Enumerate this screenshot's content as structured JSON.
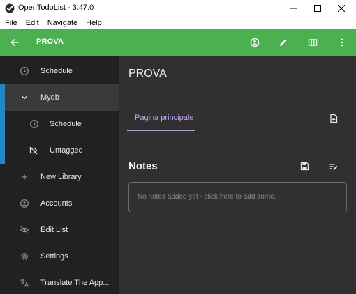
{
  "window": {
    "title": "OpenTodoList - 3.47.0",
    "controls": [
      "minimize-icon",
      "maximize-icon",
      "close-icon"
    ]
  },
  "menubar": {
    "items": [
      "File",
      "Edit",
      "Navigate",
      "Help"
    ]
  },
  "appbar": {
    "title": "PROVA",
    "back_icon": "arrow-left-icon",
    "actions": [
      "account-icon",
      "pencil-icon",
      "columns-icon",
      "more-vert-icon"
    ],
    "color": "#4caf50"
  },
  "sidebar": {
    "accent_color": "#1e88c8",
    "items": [
      {
        "label": "Schedule",
        "icon": "clock-icon"
      },
      {
        "label": "Mydb",
        "icon": "chevron-down-icon",
        "selected": true
      },
      {
        "label": "Schedule",
        "icon": "clock-icon"
      },
      {
        "label": "Untagged",
        "icon": "tag-off-icon"
      },
      {
        "label": "New Library",
        "icon": "plus-icon"
      },
      {
        "label": "Accounts",
        "icon": "account-icon"
      },
      {
        "label": "Edit List",
        "icon": "eye-off-icon"
      },
      {
        "label": "Settings",
        "icon": "gear-icon"
      },
      {
        "label": "Translate The App...",
        "icon": "translate-icon"
      }
    ]
  },
  "main": {
    "page_title": "PROVA",
    "tabs": [
      {
        "label": "Pagina principale",
        "active": true
      }
    ],
    "notes": {
      "heading": "Notes",
      "empty_text": "No notes added yet - click here to add some."
    },
    "accent_color": "#b39ddb"
  }
}
